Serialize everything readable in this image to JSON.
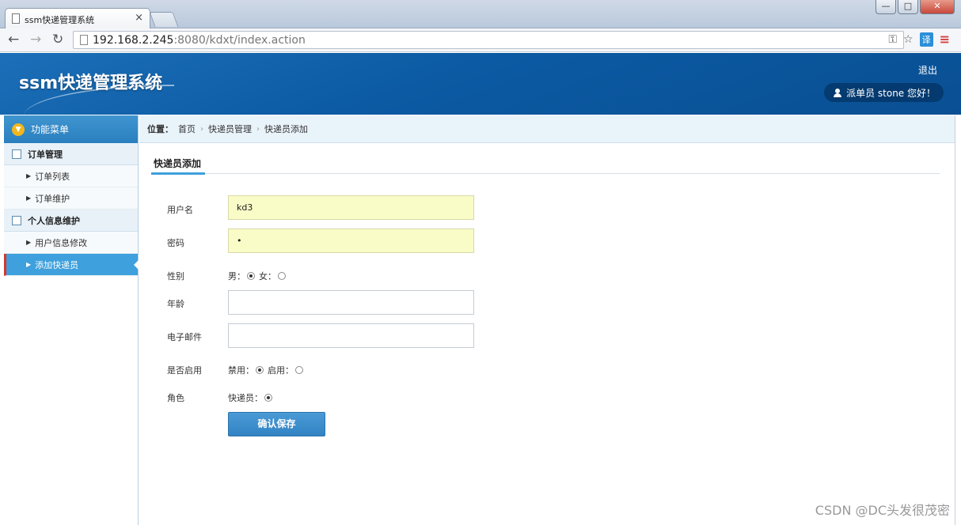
{
  "browser": {
    "tab_title": "ssm快递管理系统",
    "tab_close": "×",
    "url_host": "192.168.2.245",
    "url_rest": ":8080/kdxt/index.action",
    "win_min": "—",
    "win_max": "□",
    "win_close": "✕"
  },
  "header": {
    "logo": "ssm快递管理系统",
    "logout": "退出",
    "user_greeting": "派单员  stone 您好！"
  },
  "sidebar": {
    "title": "功能菜单",
    "groups": [
      {
        "label": "订单管理",
        "items": [
          {
            "label": "订单列表"
          },
          {
            "label": "订单维护"
          }
        ]
      },
      {
        "label": "个人信息维护",
        "items": [
          {
            "label": "用户信息修改"
          },
          {
            "label": "添加快递员"
          }
        ]
      }
    ]
  },
  "breadcrumb": {
    "label": "位置：",
    "items": [
      "首页",
      "快递员管理",
      "快递员添加"
    ]
  },
  "panel": {
    "title": "快递员添加"
  },
  "form": {
    "username": {
      "label": "用户名",
      "value": "kd3"
    },
    "password": {
      "label": "密码",
      "value": "•"
    },
    "gender": {
      "label": "性别",
      "options": [
        "男：",
        "女："
      ],
      "selected": 0
    },
    "age": {
      "label": "年龄",
      "value": ""
    },
    "email": {
      "label": "电子邮件",
      "value": ""
    },
    "enabled": {
      "label": "是否启用",
      "options": [
        "禁用：",
        "启用："
      ],
      "selected": 0
    },
    "role": {
      "label": "角色",
      "options": [
        "快递员："
      ],
      "selected": 0
    },
    "save_label": "确认保存"
  },
  "watermark": "CSDN @DC头发很茂密"
}
